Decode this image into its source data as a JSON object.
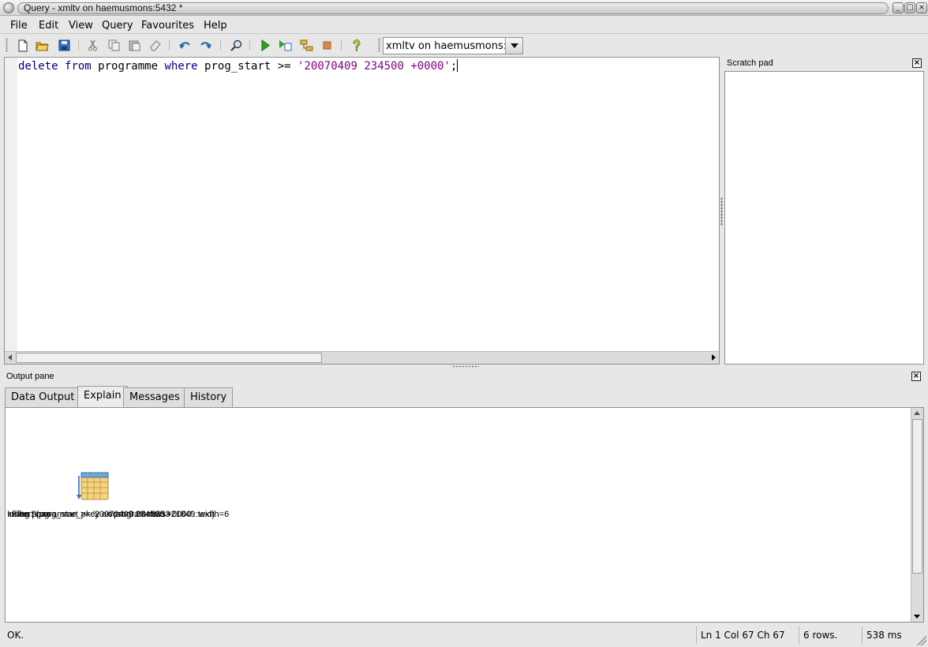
{
  "window": {
    "title": "Query - xmltv on haemusmons:5432 *"
  },
  "menu": [
    {
      "label": "File"
    },
    {
      "label": "Edit"
    },
    {
      "label": "View"
    },
    {
      "label": "Query"
    },
    {
      "label": "Favourites"
    },
    {
      "label": "Help"
    }
  ],
  "toolbar": {
    "icons": [
      "new-file-icon",
      "open-folder-icon",
      "save-icon",
      "cut-icon",
      "copy-icon",
      "paste-icon",
      "clear-eraser-icon",
      "undo-icon",
      "redo-icon",
      "find-icon",
      "execute-icon",
      "execute-to-file-icon",
      "explain-icon",
      "cancel-icon",
      "hint-icon"
    ],
    "connection": "xmltv on haemusmons:5432"
  },
  "editor": {
    "tokens": {
      "t1": "delete",
      "t2": " ",
      "t3": "from",
      "t4": " programme ",
      "t5": "where",
      "t6": " prog_start >= ",
      "t7": "'20070409 234500 +0000'",
      "t8": ";"
    },
    "colors": {
      "keyword": "#00007f",
      "string": "#7f007f"
    }
  },
  "scratch": {
    "title": "Scratch pad"
  },
  "output": {
    "title": "Output pane",
    "tabs": [
      {
        "label": "Data Output"
      },
      {
        "label": "Explain",
        "active": true
      },
      {
        "label": "Messages"
      },
      {
        "label": "History"
      }
    ],
    "plan_labels": [
      "Index Scan",
      "using programme_pkey on programme",
      "cost=0.00..2353",
      "rows=21849",
      "width=6",
      "Filter: (prog_start >= '20070409 234500 +0000'::text)"
    ],
    "plan_icon": "table-index-scan-icon"
  },
  "status": {
    "message": "OK.",
    "position": "Ln 1 Col 67 Ch 67",
    "rows": "6 rows.",
    "time": "538 ms"
  }
}
